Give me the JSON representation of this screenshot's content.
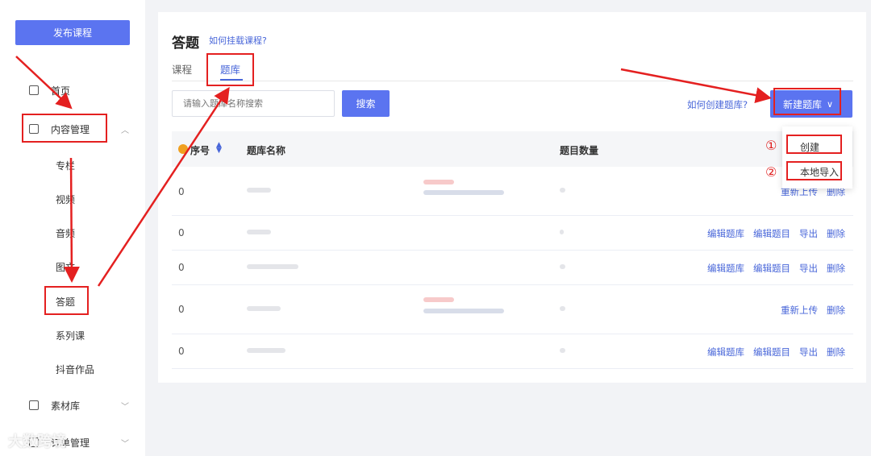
{
  "sidebar": {
    "publish_label": "发布课程",
    "items": [
      {
        "label": "首页"
      },
      {
        "label": "内容管理"
      },
      {
        "label": "素材库"
      },
      {
        "label": "订单管理"
      }
    ],
    "sub_items": [
      {
        "label": "专栏"
      },
      {
        "label": "视频"
      },
      {
        "label": "音频"
      },
      {
        "label": "图文"
      },
      {
        "label": "答题"
      },
      {
        "label": "系列课"
      },
      {
        "label": "抖音作品"
      }
    ]
  },
  "header": {
    "title": "答题",
    "help_link": "如何挂载课程?"
  },
  "tabs": [
    {
      "label": "课程"
    },
    {
      "label": "题库"
    }
  ],
  "toolbar": {
    "search_placeholder": "请输入题库名称搜索",
    "search_label": "搜索",
    "create_help": "如何创建题库?",
    "new_bank_label": "新建题库"
  },
  "dropdown": {
    "items": [
      {
        "label": "创建",
        "mark": "①"
      },
      {
        "label": "本地导入",
        "mark": "②"
      }
    ]
  },
  "table": {
    "headers": {
      "index": "序号",
      "name": "题库名称",
      "count": "题目数量"
    },
    "rows": [
      {
        "index": "0",
        "actions": [
          "重新上传",
          "删除"
        ]
      },
      {
        "index": "0",
        "actions": [
          "编辑题库",
          "编辑题目",
          "导出",
          "删除"
        ]
      },
      {
        "index": "0",
        "actions": [
          "编辑题库",
          "编辑题目",
          "导出",
          "删除"
        ]
      },
      {
        "index": "0",
        "actions": [
          "重新上传",
          "删除"
        ]
      },
      {
        "index": "0",
        "actions": [
          "编辑题库",
          "编辑题目",
          "导出",
          "删除"
        ]
      }
    ]
  },
  "watermark": "大数跨境",
  "colors": {
    "accent": "#5b74f0",
    "link": "#4866d9",
    "annotation": "#e42020"
  }
}
